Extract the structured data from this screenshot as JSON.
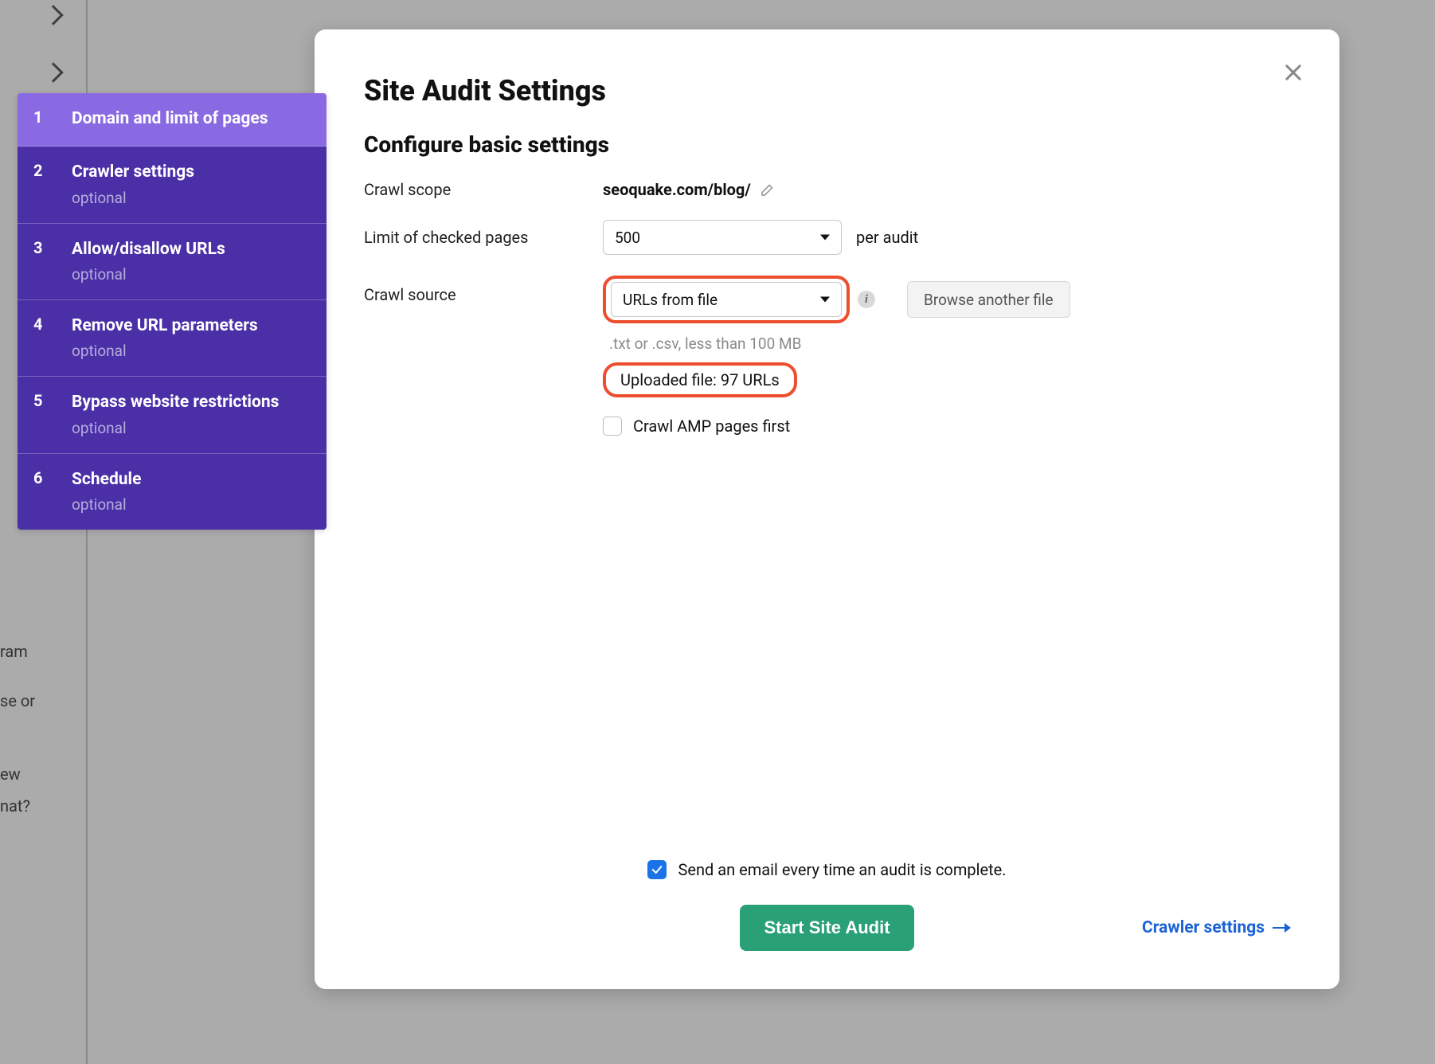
{
  "wizard": {
    "steps": [
      {
        "num": "1",
        "label": "Domain and limit of pages",
        "sub": ""
      },
      {
        "num": "2",
        "label": "Crawler settings",
        "sub": "optional"
      },
      {
        "num": "3",
        "label": "Allow/disallow URLs",
        "sub": "optional"
      },
      {
        "num": "4",
        "label": "Remove URL parameters",
        "sub": "optional"
      },
      {
        "num": "5",
        "label": "Bypass website restrictions",
        "sub": "optional"
      },
      {
        "num": "6",
        "label": "Schedule",
        "sub": "optional"
      }
    ]
  },
  "modal": {
    "title": "Site Audit Settings",
    "subtitle": "Configure basic settings",
    "crawl_scope_label": "Crawl scope",
    "crawl_scope_value": "seoquake.com/blog/",
    "limit_label": "Limit of checked pages",
    "limit_value": "500",
    "limit_suffix": "per audit",
    "source_label": "Crawl source",
    "source_value": "URLs from file",
    "browse_label": "Browse another file",
    "file_hint": ".txt or .csv, less than 100 MB",
    "uploaded_text": "Uploaded file: 97 URLs",
    "amp_label": "Crawl AMP pages first",
    "email_label": "Send an email every time an audit is complete.",
    "start_label": "Start Site Audit",
    "next_label": "Crawler settings"
  },
  "background_fragments": {
    "a": "ram",
    "b": "se or",
    "c": "ew",
    "d": "nat?"
  }
}
